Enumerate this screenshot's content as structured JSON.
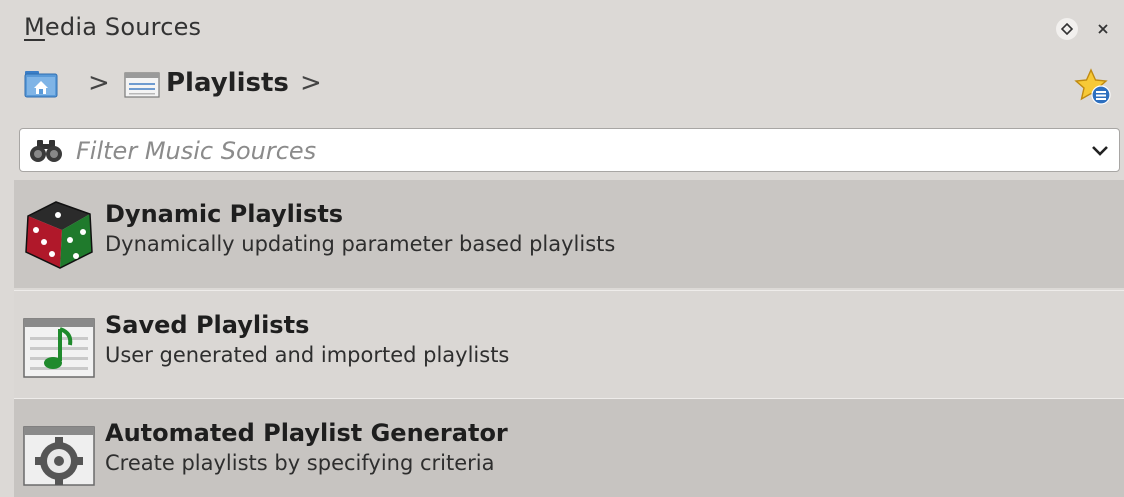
{
  "window": {
    "title": "Media Sources",
    "float_button": "◇",
    "close_button": "✕"
  },
  "breadcrumb": {
    "home_icon": "home-folder-icon",
    "separator": ">",
    "current": "Playlists",
    "favorite_icon": "bookmark-star-icon"
  },
  "filter": {
    "placeholder": "Filter Music Sources",
    "value": "",
    "icon": "binoculars-icon"
  },
  "sources": [
    {
      "title": "Dynamic Playlists",
      "subtitle": "Dynamically updating parameter based playlists",
      "icon": "dice-icon"
    },
    {
      "title": "Saved Playlists",
      "subtitle": "User generated and imported playlists",
      "icon": "music-note-playlist-icon"
    },
    {
      "title": "Automated Playlist Generator",
      "subtitle": "Create playlists by specifying criteria",
      "icon": "gear-playlist-icon"
    }
  ],
  "colors": {
    "panel_background": "#dcd9d6",
    "selected_row": "#c9c6c3",
    "dice_red": "#b0182a",
    "dice_green": "#1f7a2c"
  }
}
